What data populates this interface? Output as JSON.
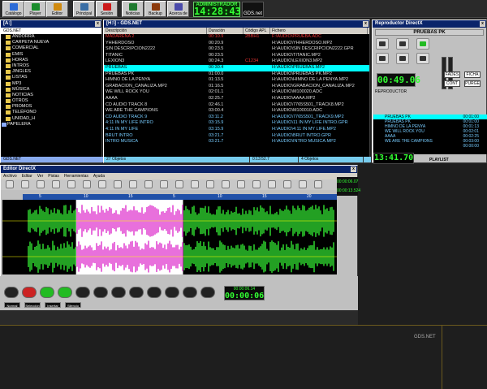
{
  "toolbar": {
    "buttons": [
      {
        "label": "Catálogo",
        "icon": "catalog-icon",
        "color": "#2c6bd6"
      },
      {
        "label": "Player",
        "icon": "player-icon",
        "color": "#1a8c2c"
      },
      {
        "label": "Editor",
        "icon": "editor-icon",
        "color": "#d08a10"
      },
      {
        "label": "Principal",
        "icon": "home-icon",
        "color": "#3a6ea5"
      },
      {
        "label": "Sesión",
        "icon": "no-entry-icon",
        "color": "#cc1a1a"
      },
      {
        "label": "Noticias",
        "icon": "news-icon",
        "color": "#207a30"
      },
      {
        "label": "Backup",
        "icon": "backup-icon",
        "color": "#8c3a0c"
      },
      {
        "label": "Acerca de",
        "icon": "info-icon",
        "color": "#4a4aaa"
      }
    ],
    "user": "ADMINISTRADOR",
    "clock": "14:28:43",
    "logo": "GDS.net"
  },
  "tree": {
    "title": "[A:]",
    "path": "GDS.NET",
    "items": [
      {
        "label": "ANDORRA",
        "level": 1
      },
      {
        "label": "CARPETA NUEVA",
        "level": 1
      },
      {
        "label": "COMERCIAL",
        "level": 1
      },
      {
        "label": "EMIS",
        "level": 1
      },
      {
        "label": "HORAS",
        "level": 1
      },
      {
        "label": "INTROS",
        "level": 1
      },
      {
        "label": "JINGLES",
        "level": 1
      },
      {
        "label": "LISTAS",
        "level": 1
      },
      {
        "label": "MP3",
        "level": 1
      },
      {
        "label": "MÚSICA",
        "level": 1
      },
      {
        "label": "NOTICIAS",
        "level": 1
      },
      {
        "label": "OTROS",
        "level": 1
      },
      {
        "label": "PROMOS",
        "level": 1
      },
      {
        "label": "TELÉFONO",
        "level": 1
      },
      {
        "label": "UNIDAD_H",
        "level": 1
      },
      {
        "label": "PAPELERA",
        "level": 0
      }
    ],
    "footer": "GDS.NET"
  },
  "list": {
    "title": "[H:\\] - GDS.NET",
    "headers": [
      "Descripción",
      "Duración",
      "Código APL",
      "Fichero"
    ],
    "rows": [
      {
        "d": "MADARENA 2",
        "t": "00:10.9",
        "c": "2BBH1",
        "f": "F:\\AUDIO\\PRUEBA.ADC",
        "color": "#e33",
        "sel": false
      },
      {
        "d": "YHHERDOSO",
        "t": "00:20.9",
        "c": "",
        "f": "H:\\AUDIO\\YHHERDOSO.MP2",
        "color": "#ddd",
        "sel": false
      },
      {
        "d": "SIN DESCRIPCIÓN2222",
        "t": "00:23.5",
        "c": "",
        "f": "H:\\AUDIO\\SIN DESCRIPCIÓN2222.GPR",
        "color": "#ddd",
        "sel": false
      },
      {
        "d": "TITANIC",
        "t": "00:23.5",
        "c": "",
        "f": "H:\\AUDIO\\TITANIC.MP2",
        "color": "#ddd",
        "sel": false
      },
      {
        "d": "LEXION3",
        "t": "00:24.3",
        "c": "C1234",
        "f": "H:\\AUDIO\\LEXION3.MP2",
        "color": "#ddd",
        "sel": false
      },
      {
        "d": "PRUEBAS",
        "t": "00:30.4",
        "c": "",
        "f": "H:\\AUDIO\\PRUEBAS.MP2",
        "color": "#000",
        "sel": true
      },
      {
        "d": "PRUEBAS PK",
        "t": "01:00.0",
        "c": "",
        "f": "H:\\AUDIO\\PRUEBAS PK.MP2",
        "color": "#ddd",
        "sel": false
      },
      {
        "d": "HIMNO DE LA PENYA",
        "t": "01:13.5",
        "c": "",
        "f": "H:\\AUDIO\\HIMNO DE LA PENYA.MP2",
        "color": "#ddd",
        "sel": false
      },
      {
        "d": "GRABACION_CANALIZA.MP2",
        "t": "01:16.5",
        "c": "",
        "f": "H:\\AUDIO\\GRABACION_CANALIZA.MP2",
        "color": "#ddd",
        "sel": false
      },
      {
        "d": "WE WILL ROCK YOU",
        "t": "02:01.1",
        "c": "",
        "f": "H:\\AUDIO\\M100020.ADC",
        "color": "#ddd",
        "sel": false
      },
      {
        "d": "AAAA",
        "t": "02:25.7",
        "c": "",
        "f": "H:\\AUDIO\\AAAA.MP2",
        "color": "#ddd",
        "sel": false
      },
      {
        "d": "CD AUDIO TRACK 8",
        "t": "02:46.1",
        "c": "",
        "f": "H:\\AUDIO\\7765S501_TRACK8.MP2",
        "color": "#ddd",
        "sel": false
      },
      {
        "d": "WE ARE THE CAMPIONS",
        "t": "03:00.4",
        "c": "",
        "f": "H:\\AUDIO\\M100010.ADC",
        "color": "#ddd",
        "sel": false
      },
      {
        "d": "CD AUDIO TRACK 9",
        "t": "03:11.2",
        "c": "",
        "f": "H:\\AUDIO\\7765S501_TRACK9.MP2",
        "color": "#7cf",
        "sel": false
      },
      {
        "d": "4:11 IN MY LIFE INTRO",
        "t": "03:15.9",
        "c": "",
        "f": "H:\\AUDIO\\11 IN MY LIFE INTRO.GPR",
        "color": "#7cf",
        "sel": false
      },
      {
        "d": "4:11 IN MY LIFE",
        "t": "03:15.9",
        "c": "",
        "f": "H:\\AUDIO\\4:11 IN MY LIFE.MP2",
        "color": "#7cf",
        "sel": false
      },
      {
        "d": "BRUT INTRO",
        "t": "03:21.7",
        "c": "",
        "f": "H:\\AUDIO\\BRUT INTRO.GPR",
        "color": "#7cf",
        "sel": false
      },
      {
        "d": "INTRO MUSICA",
        "t": "03:21.7",
        "c": "",
        "f": "H:\\AUDIO\\INTRO MUSICA.MP2",
        "color": "#7cf",
        "sel": false
      }
    ],
    "footer": [
      "27 Objetos",
      "0:13:52.7",
      "4 Objetos"
    ]
  },
  "player": {
    "title": "Reproductor DirectX",
    "now_playing": "PRUEBAS PK",
    "time": "00:49.06",
    "side_buttons": [
      "FADES",
      "FICHA",
      "CONT",
      "PURGE"
    ],
    "label": "REPRODUCTOR",
    "queue": [
      {
        "n": "PRUEBAS PK",
        "t": "00:01:00"
      },
      {
        "n": "PRUEBAS PK",
        "t": "00:01:00"
      },
      {
        "n": "HIMNO DE LA PENYA",
        "t": "00:01:13"
      },
      {
        "n": "WE WILL ROCK YOU",
        "t": "00:02:01"
      },
      {
        "n": "AAAA",
        "t": "00:02:25"
      },
      {
        "n": "WE ARE THE CAMPIONS",
        "t": "00:03:00"
      },
      {
        "n": "",
        "t": "00:00:00"
      }
    ],
    "clock": "13:41.70",
    "playlist_label": "PLAYLIST"
  },
  "editor": {
    "title": "Editor DirectX",
    "menu": [
      "Archivo",
      "Editar",
      "Ver",
      "Pistas",
      "Herramientas",
      "Ayuda"
    ],
    "time_total": "00:00:06.07",
    "time_sel": "00:00:13.524",
    "time_pos": "00:00:06",
    "time_end": "00:00:06.14",
    "clip_btns": [
      "Normal",
      "Selección",
      "Insertar",
      "Silencio"
    ],
    "ruler_ticks": [
      "5",
      "10",
      "15",
      "5",
      "10",
      "15",
      "20"
    ],
    "selection": {
      "start": 0.22,
      "end": 0.54
    },
    "colors": {
      "wave": "#2fd62f",
      "sel": "#e040d0",
      "bg": "#000"
    }
  }
}
